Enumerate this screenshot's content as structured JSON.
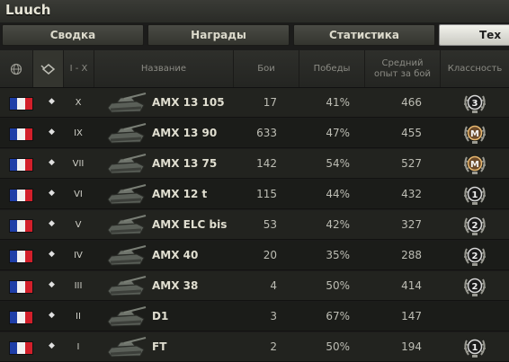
{
  "title": "Luuch",
  "tabs": [
    "Сводка",
    "Награды",
    "Статистика",
    "Тех"
  ],
  "headers": {
    "nation_icon": "globe-icon",
    "type_icon": "tank-type-icon",
    "tier": "I - X",
    "name": "Название",
    "battles": "Бои",
    "wins": "Победы",
    "avg_xp_line1": "Средний",
    "avg_xp_line2": "опыт за бой",
    "mastery": "Классность"
  },
  "colors": {
    "flag_blue": "#1f3fa8",
    "flag_white": "#f2f2f2",
    "flag_red": "#d21f2a"
  },
  "rows": [
    {
      "tier": "X",
      "name": "AMX 13 105",
      "battles": "17",
      "wins": "41%",
      "xp": "466",
      "badge": "3"
    },
    {
      "tier": "IX",
      "name": "AMX 13 90",
      "battles": "633",
      "wins": "47%",
      "xp": "455",
      "badge": "M"
    },
    {
      "tier": "VII",
      "name": "AMX 13 75",
      "battles": "142",
      "wins": "54%",
      "xp": "527",
      "badge": "M"
    },
    {
      "tier": "VI",
      "name": "AMX 12 t",
      "battles": "115",
      "wins": "44%",
      "xp": "432",
      "badge": "1"
    },
    {
      "tier": "V",
      "name": "AMX ELC bis",
      "battles": "53",
      "wins": "42%",
      "xp": "327",
      "badge": "2"
    },
    {
      "tier": "IV",
      "name": "AMX 40",
      "battles": "20",
      "wins": "35%",
      "xp": "288",
      "badge": "2"
    },
    {
      "tier": "III",
      "name": "AMX 38",
      "battles": "4",
      "wins": "50%",
      "xp": "414",
      "badge": "2"
    },
    {
      "tier": "II",
      "name": "D1",
      "battles": "3",
      "wins": "67%",
      "xp": "147",
      "badge": ""
    },
    {
      "tier": "I",
      "name": "FT",
      "battles": "2",
      "wins": "50%",
      "xp": "194",
      "badge": "1"
    }
  ]
}
